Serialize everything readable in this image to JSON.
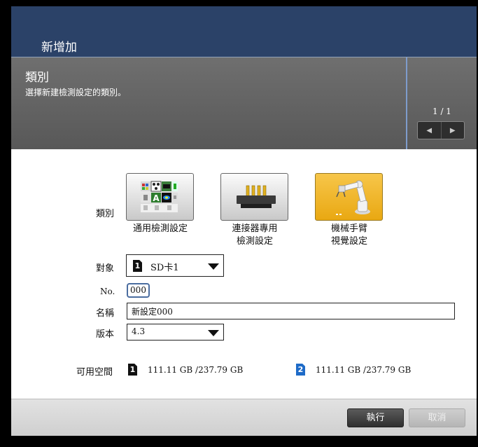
{
  "window": {
    "title": "新增加"
  },
  "header": {
    "title": "類別",
    "subtitle": "選擇新建檢測設定的類別。",
    "page_indicator": "1 / 1",
    "prev_glyph": "◀",
    "next_glyph": "▶"
  },
  "category": {
    "label": "類別",
    "items": [
      {
        "line1": "通用檢測設定",
        "line2": "",
        "icon": "general-inspection-icon",
        "selected": false
      },
      {
        "line1": "連接器專用",
        "line2": "檢測設定",
        "icon": "connector-icon",
        "selected": false
      },
      {
        "line1": "機械手臂",
        "line2": "視覺設定",
        "icon": "robot-arm-icon",
        "selected": true
      }
    ]
  },
  "target": {
    "label": "對象",
    "card": "1",
    "value": "SD卡1"
  },
  "number": {
    "label": "No.",
    "value": "000"
  },
  "name": {
    "label": "名稱",
    "value": "新設定000"
  },
  "version": {
    "label": "版本",
    "value": "4.3"
  },
  "space": {
    "label": "可用空間",
    "card1": {
      "num": "1",
      "text": "111.11 GB /237.79 GB"
    },
    "card2": {
      "num": "2",
      "text": "111.11 GB /237.79 GB"
    }
  },
  "footer": {
    "execute": "執行",
    "cancel": "取消"
  },
  "colors": {
    "title_bar": "#2b4268",
    "selected_category": "#eeb123",
    "sd2_accent": "#1e6bc8"
  }
}
